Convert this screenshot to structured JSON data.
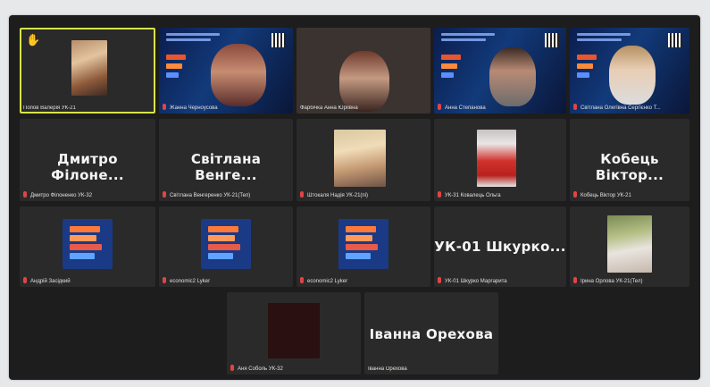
{
  "tiles": [
    {
      "label": "Попов Валерія УК-21",
      "hand": "✋"
    },
    {
      "label": "Жанна Черноусова"
    },
    {
      "label": "Фарбічка Анна Юріївна"
    },
    {
      "label": "Анна Степанова"
    },
    {
      "label": "Світлана Олегівна Сергієнко Т..."
    },
    {
      "big": "Дмитро Філоне...",
      "label": "Дмитро Філоненко УК-32"
    },
    {
      "big": "Світлана Венге...",
      "label": "Світлана Венгеренко УК-21(Тел)"
    },
    {
      "label": "Штокаля Надія УК-21(пі)"
    },
    {
      "label": "УК-31 Ковалець Ольга"
    },
    {
      "big": "Кобець Віктор...",
      "label": "Кобець Віктор УК-21"
    },
    {
      "label": "Андрій Засідкий"
    },
    {
      "label": "economic2 Lyker"
    },
    {
      "label": "economic2 Lyker"
    },
    {
      "big": "УК-01 Шкурко...",
      "label": "УК-01 Шкурко Маргарита"
    },
    {
      "label": "Ірина Орлова УК-21(Тел)"
    },
    {
      "label": "Аня Соболь УК-32"
    },
    {
      "big": "Іванна Орехова",
      "label": "Іванна Орехова"
    }
  ],
  "colors": {
    "background": "#1d1d1d",
    "tile": "#2a2a2b",
    "active_outline": "#d8e34a",
    "mic_muted": "#e24444"
  }
}
